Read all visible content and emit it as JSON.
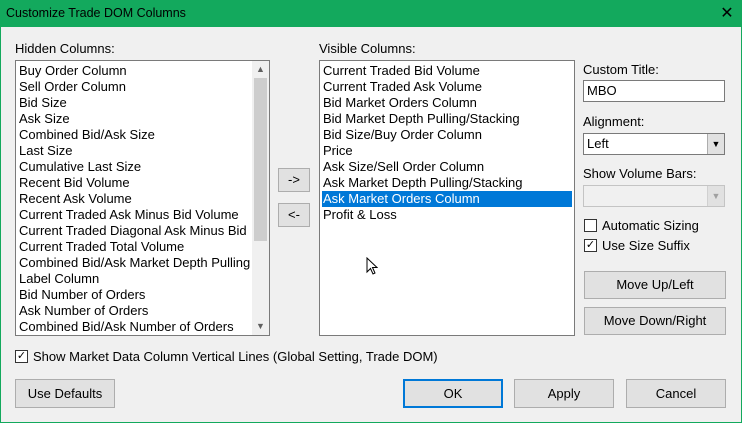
{
  "window": {
    "title": "Customize Trade DOM Columns",
    "close_glyph": "✕"
  },
  "hidden_columns": {
    "label": "Hidden Columns:",
    "items": [
      "Buy Order Column",
      "Sell Order Column",
      "Bid Size",
      "Ask Size",
      "Combined Bid/Ask Size",
      "Last Size",
      "Cumulative Last Size",
      "Recent Bid Volume",
      "Recent Ask Volume",
      "Current Traded Ask Minus Bid Volume",
      "Current Traded Diagonal Ask Minus Bid",
      "Current Traded Total Volume",
      "Combined Bid/Ask Market Depth Pulling",
      "Label Column",
      "Bid Number of Orders",
      "Ask Number of Orders",
      "Combined Bid/Ask Number of Orders"
    ]
  },
  "transfer": {
    "add_label": "->",
    "remove_label": "<-"
  },
  "visible_columns": {
    "label": "Visible Columns:",
    "selected": "Ask Market Orders Column",
    "items": [
      "Current Traded Bid Volume",
      "Current Traded Ask Volume",
      "Bid Market Orders Column",
      "Bid Market Depth Pulling/Stacking",
      "Bid Size/Buy Order Column",
      "Price",
      "Ask Size/Sell Order Column",
      "Ask Market Depth Pulling/Stacking",
      "Ask Market Orders Column",
      "Profit & Loss"
    ]
  },
  "settings": {
    "custom_title_label": "Custom Title:",
    "custom_title_value": "MBO",
    "alignment_label": "Alignment:",
    "alignment_value": "Left",
    "volume_bars_label": "Show Volume Bars:",
    "volume_bars_value": "",
    "automatic_sizing_label": "Automatic Sizing",
    "automatic_sizing_checked": false,
    "size_suffix_label": "Use Size Suffix",
    "size_suffix_checked": true,
    "move_up_label": "Move Up/Left",
    "move_down_label": "Move Down/Right"
  },
  "vertical_lines": {
    "label": "Show Market Data Column Vertical Lines (Global Setting, Trade DOM)",
    "checked": true
  },
  "footer": {
    "defaults_label": "Use Defaults",
    "ok_label": "OK",
    "apply_label": "Apply",
    "cancel_label": "Cancel"
  },
  "colors": {
    "title_bar": "#13a95d",
    "selection": "#0078d7"
  }
}
